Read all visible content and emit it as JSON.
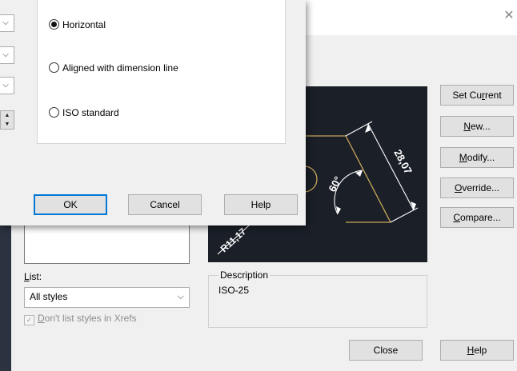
{
  "main_dialog": {
    "close_glyph": "✕",
    "buttons": {
      "set_current": {
        "prefix": "Set Cu",
        "mn": "r",
        "suffix": "rent"
      },
      "new": {
        "prefix": "",
        "mn": "N",
        "suffix": "ew..."
      },
      "modify": {
        "prefix": "",
        "mn": "M",
        "suffix": "odify..."
      },
      "override": {
        "prefix": "",
        "mn": "O",
        "suffix": "verride..."
      },
      "compare": {
        "prefix": "",
        "mn": "C",
        "suffix": "ompare..."
      },
      "close": {
        "label": "Close"
      },
      "help": {
        "prefix": "",
        "mn": "H",
        "suffix": "elp"
      }
    },
    "list": {
      "label_mn": "L",
      "label_rest": "ist:",
      "selected": "All styles",
      "chevron": "⌵"
    },
    "xrefs": {
      "prefix": "",
      "mn": "D",
      "suffix": "on't list styles in Xrefs",
      "checked": true
    },
    "preview": {
      "dim_linear": "28,07",
      "dim_angle": "60°",
      "dim_radius": "R11,17"
    },
    "description": {
      "title": "Description",
      "text": "ISO-25"
    }
  },
  "sub_dialog": {
    "alignment_options": [
      {
        "label": "Horizontal",
        "selected": true
      },
      {
        "label": "Aligned with dimension line",
        "selected": false
      },
      {
        "label": "ISO standard",
        "selected": false
      }
    ],
    "buttons": {
      "ok": "OK",
      "cancel": "Cancel",
      "help": "Help"
    }
  },
  "colors": {
    "preview_bg": "#1b1f28",
    "preview_lines": "#ffffff",
    "preview_geometry": "#c8a85a",
    "ok_focus_border": "#0078d7"
  }
}
